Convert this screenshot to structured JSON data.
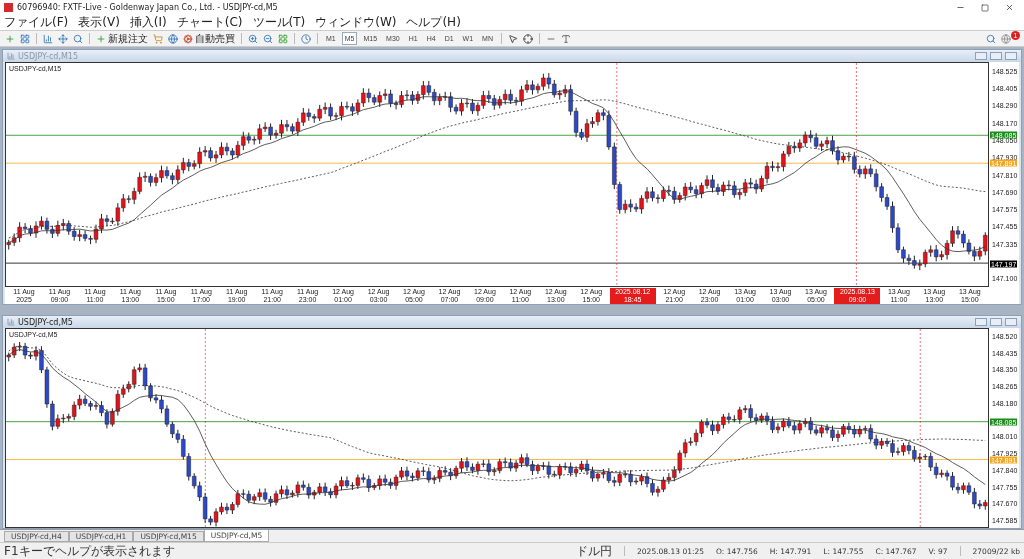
{
  "window": {
    "title": "60796940: FXTF-Live - Goldenway Japan Co., Ltd. - USDJPY-cd,M5"
  },
  "menu": [
    "ファイル(F)",
    "表示(V)",
    "挿入(I)",
    "チャート(C)",
    "ツール(T)",
    "ウィンドウ(W)",
    "ヘルプ(H)"
  ],
  "toolbar": {
    "order_button": "新規注文",
    "auto_trade_button": "自動売買",
    "timeframes": [
      {
        "label": "M1",
        "selected": false
      },
      {
        "label": "M5",
        "selected": true
      },
      {
        "label": "M15",
        "selected": false
      },
      {
        "label": "M30",
        "selected": false
      },
      {
        "label": "H1",
        "selected": false
      },
      {
        "label": "H4",
        "selected": false
      },
      {
        "label": "D1",
        "selected": false
      },
      {
        "label": "W1",
        "selected": false
      },
      {
        "label": "MN",
        "selected": false
      }
    ],
    "notifications": "1"
  },
  "charts": [
    {
      "window_title": "USDJPY-cd,M15",
      "active": false,
      "label": "USDJPY-cd,M15",
      "price_ticks": [
        "148.525",
        "148.405",
        "148.290",
        "148.170",
        "148.050",
        "147.930",
        "147.810",
        "147.690",
        "147.575",
        "147.455",
        "147.335",
        "147.100"
      ],
      "levels": [
        {
          "label": "148.085",
          "color": "#1c8a1c"
        },
        {
          "label": "147.891",
          "color": "#f5a623"
        },
        {
          "label": "147.197",
          "color": "#000000"
        }
      ],
      "time_axis": [
        {
          "kind": "tick",
          "label": "11 Aug 2025"
        },
        {
          "kind": "tick",
          "label": "11 Aug 09:00"
        },
        {
          "kind": "tick",
          "label": "11 Aug 11:00"
        },
        {
          "kind": "tick",
          "label": "11 Aug 13:00"
        },
        {
          "kind": "tick",
          "label": "11 Aug 15:00"
        },
        {
          "kind": "tick",
          "label": "11 Aug 17:00"
        },
        {
          "kind": "tick",
          "label": "11 Aug 19:00"
        },
        {
          "kind": "tick",
          "label": "11 Aug 21:00"
        },
        {
          "kind": "tick",
          "label": "11 Aug 23:00"
        },
        {
          "kind": "tick",
          "label": "12 Aug 01:00"
        },
        {
          "kind": "tick",
          "label": "12 Aug 03:00"
        },
        {
          "kind": "tick",
          "label": "12 Aug 05:00"
        },
        {
          "kind": "tick",
          "label": "12 Aug 07:00"
        },
        {
          "kind": "tick",
          "label": "12 Aug 09:00"
        },
        {
          "kind": "tick",
          "label": "12 Aug 11:00"
        },
        {
          "kind": "tick",
          "label": "12 Aug 13:00"
        },
        {
          "kind": "tick",
          "label": "12 Aug 15:00"
        },
        {
          "kind": "marker",
          "label": "2025.08.12 18:45"
        },
        {
          "kind": "tick",
          "label": "12 Aug 21:00"
        },
        {
          "kind": "tick",
          "label": "12 Aug 23:00"
        },
        {
          "kind": "tick",
          "label": "13 Aug 01:00"
        },
        {
          "kind": "tick",
          "label": "13 Aug 03:00"
        },
        {
          "kind": "tick",
          "label": "13 Aug 05:00"
        },
        {
          "kind": "marker",
          "label": "2025.08.13 09:00"
        },
        {
          "kind": "tick",
          "label": "13 Aug 11:00"
        },
        {
          "kind": "tick",
          "label": "13 Aug 13:00"
        },
        {
          "kind": "tick",
          "label": "13 Aug 15:00"
        }
      ]
    },
    {
      "window_title": "USDJPY-cd,M5",
      "active": true,
      "label": "USDJPY-cd,M5",
      "price_ticks": [
        "148.520",
        "148.435",
        "148.350",
        "148.265",
        "148.180",
        "148.010",
        "147.925",
        "147.840",
        "147.755",
        "147.670",
        "147.585"
      ],
      "levels": [
        {
          "label": "148.085",
          "color": "#1c8a1c"
        },
        {
          "label": "147.891",
          "color": "#f5a623"
        }
      ]
    }
  ],
  "tabs": [
    {
      "label": "USDJPY-cd,H4",
      "selected": false
    },
    {
      "label": "USDJPY-cd,H1",
      "selected": false
    },
    {
      "label": "USDJPY-cd,M15",
      "selected": false
    },
    {
      "label": "USDJPY-cd,M5",
      "selected": true
    }
  ],
  "status_bar": {
    "help": "F1キーでヘルプが表示されます",
    "profile": "ドル円",
    "time": "2025.08.13 01:25",
    "open": "O: 147.756",
    "high": "H: 147.791",
    "low": "L: 147.755",
    "close": "C: 147.767",
    "volume": "V: 97",
    "traffic": "27009/22 kb"
  }
}
